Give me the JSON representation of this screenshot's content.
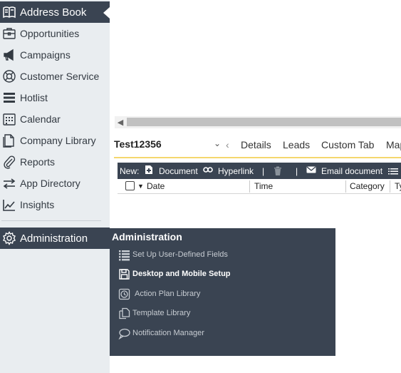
{
  "sidebar": {
    "items": [
      {
        "label": "Address Book",
        "icon": "address-book-icon",
        "active": true
      },
      {
        "label": "Opportunities",
        "icon": "briefcase-icon"
      },
      {
        "label": "Campaigns",
        "icon": "megaphone-icon"
      },
      {
        "label": "Customer Service",
        "icon": "lifebuoy-icon"
      },
      {
        "label": "Hotlist",
        "icon": "list-icon"
      },
      {
        "label": "Calendar",
        "icon": "calendar-icon"
      },
      {
        "label": "Company Library",
        "icon": "document-icon"
      },
      {
        "label": "Reports",
        "icon": "paperclip-icon"
      },
      {
        "label": "App Directory",
        "icon": "swap-arrows-icon"
      },
      {
        "label": "Insights",
        "icon": "trend-chart-icon"
      }
    ],
    "admin": {
      "label": "Administration",
      "icon": "gear-icon"
    }
  },
  "record": {
    "title": "Test12356"
  },
  "tabs": [
    "Details",
    "Leads",
    "Custom Tab",
    "Map"
  ],
  "action_bar": {
    "new_label": "New:",
    "document": "Document",
    "hyperlink": "Hyperlink",
    "email": "Email document"
  },
  "grid": {
    "columns": [
      "Date",
      "Time",
      "Category",
      "Ty"
    ]
  },
  "flyout": {
    "title": "Administration",
    "items": [
      {
        "label": "Set Up User-Defined Fields",
        "icon": "list-icon"
      },
      {
        "label": "Desktop and Mobile Setup",
        "icon": "floppy-disk-icon"
      },
      {
        "label": "Action Plan Library",
        "icon": "clock-icon"
      },
      {
        "label": "Template Library",
        "icon": "copy-icon"
      },
      {
        "label": "Notification Manager",
        "icon": "speech-bubble-icon"
      }
    ]
  },
  "colors": {
    "sidebar_bg": "#e9edf0",
    "dark_panel": "#3a4452",
    "accent_underline": "#f5d76e"
  }
}
